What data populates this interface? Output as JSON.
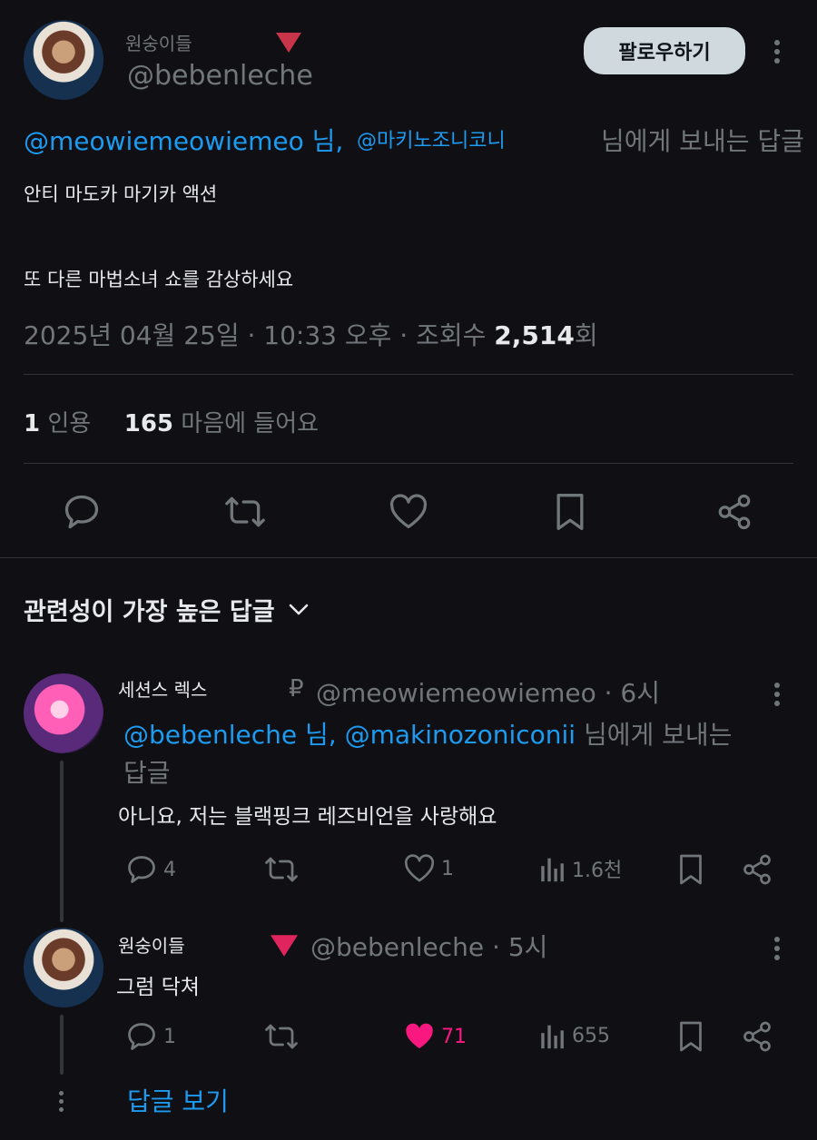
{
  "tweet": {
    "display_name": "원숭이들",
    "handle": "@bebenleche",
    "follow_label": "팔로우하기",
    "reply_to_mention1": "@meowiemeowiemeo 님,",
    "reply_to_mention2": "@마키노조니코니",
    "reply_to_suffix": "님에게 보내는 답글",
    "line1": "안티 마도카 마기카 액션",
    "line2": "또 다른 마법소녀 쇼를 감상하세요",
    "meta_prefix": "2025년 04월 25일 · 10:33 오후 · 조회수 ",
    "views": "2,514",
    "views_suffix": "회",
    "quote_count": "1",
    "quote_label": "인용",
    "like_count": "165",
    "like_label": "마음에 들어요"
  },
  "sort": {
    "label": "관련성이 가장 높은 답글"
  },
  "replies": [
    {
      "display_name": "세션스 렉스",
      "badge": "₽",
      "handle_time": "@meowiemeowiemeo · 6시",
      "mention": "@bebenleche 님, @makinozoniconii",
      "mention_suffix": "님에게 보내는",
      "mention_suffix2": "답글",
      "text": "아니요, 저는 블랙핑크 레즈비언을 사랑해요",
      "reply_count": "4",
      "like_count": "1",
      "view_count": "1.6천"
    },
    {
      "display_name": "원숭이들",
      "handle_time": "@bebenleche · 5시",
      "text": "그럼 닥쳐",
      "reply_count": "1",
      "like_count": "71",
      "view_count": "655"
    }
  ],
  "show_replies": "답글 보기",
  "colors": {
    "accent": "#1d9bf0",
    "like_active": "#f91880",
    "muted": "#71767b",
    "triangle": "#e0245e"
  }
}
